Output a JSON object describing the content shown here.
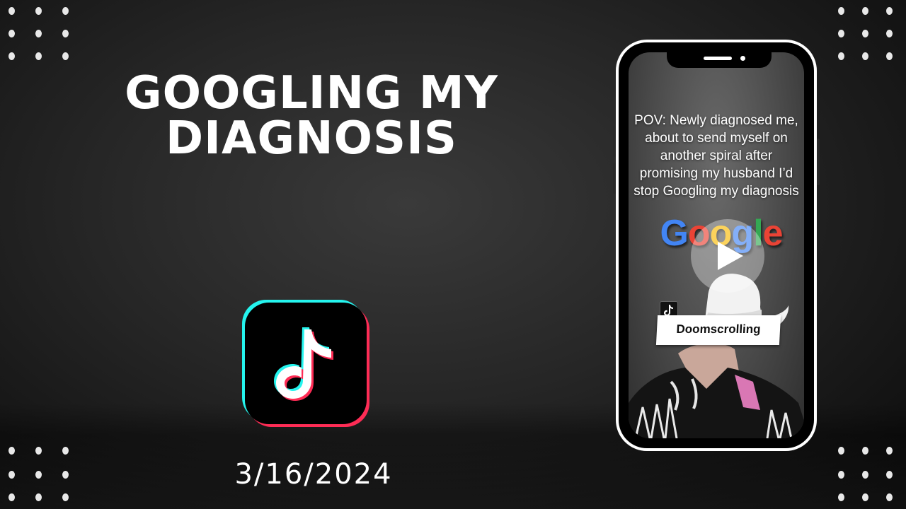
{
  "slide": {
    "title": "GOOGLING MY DIAGNOSIS",
    "date": "3/16/2024"
  },
  "phone": {
    "caption": "POV: Newly diagnosed me, about to send myself on another spiral after promising my husband I’d stop Googling my diagnosis",
    "google_logo": {
      "letters": [
        "G",
        "o",
        "o",
        "g",
        "l",
        "e"
      ],
      "colors": [
        "#4285f4",
        "#ea4335",
        "#fbbc05",
        "#4285f4",
        "#34a853",
        "#ea4335"
      ]
    },
    "tag_label": "Doomscrolling"
  },
  "icons": {
    "logo": "tiktok-logo",
    "play": "play-icon",
    "badge": "tiktok-icon"
  },
  "colors": {
    "tiktok_cyan": "#25f4ee",
    "tiktok_red": "#fe2c55",
    "phone_frame": "#ffffff"
  }
}
